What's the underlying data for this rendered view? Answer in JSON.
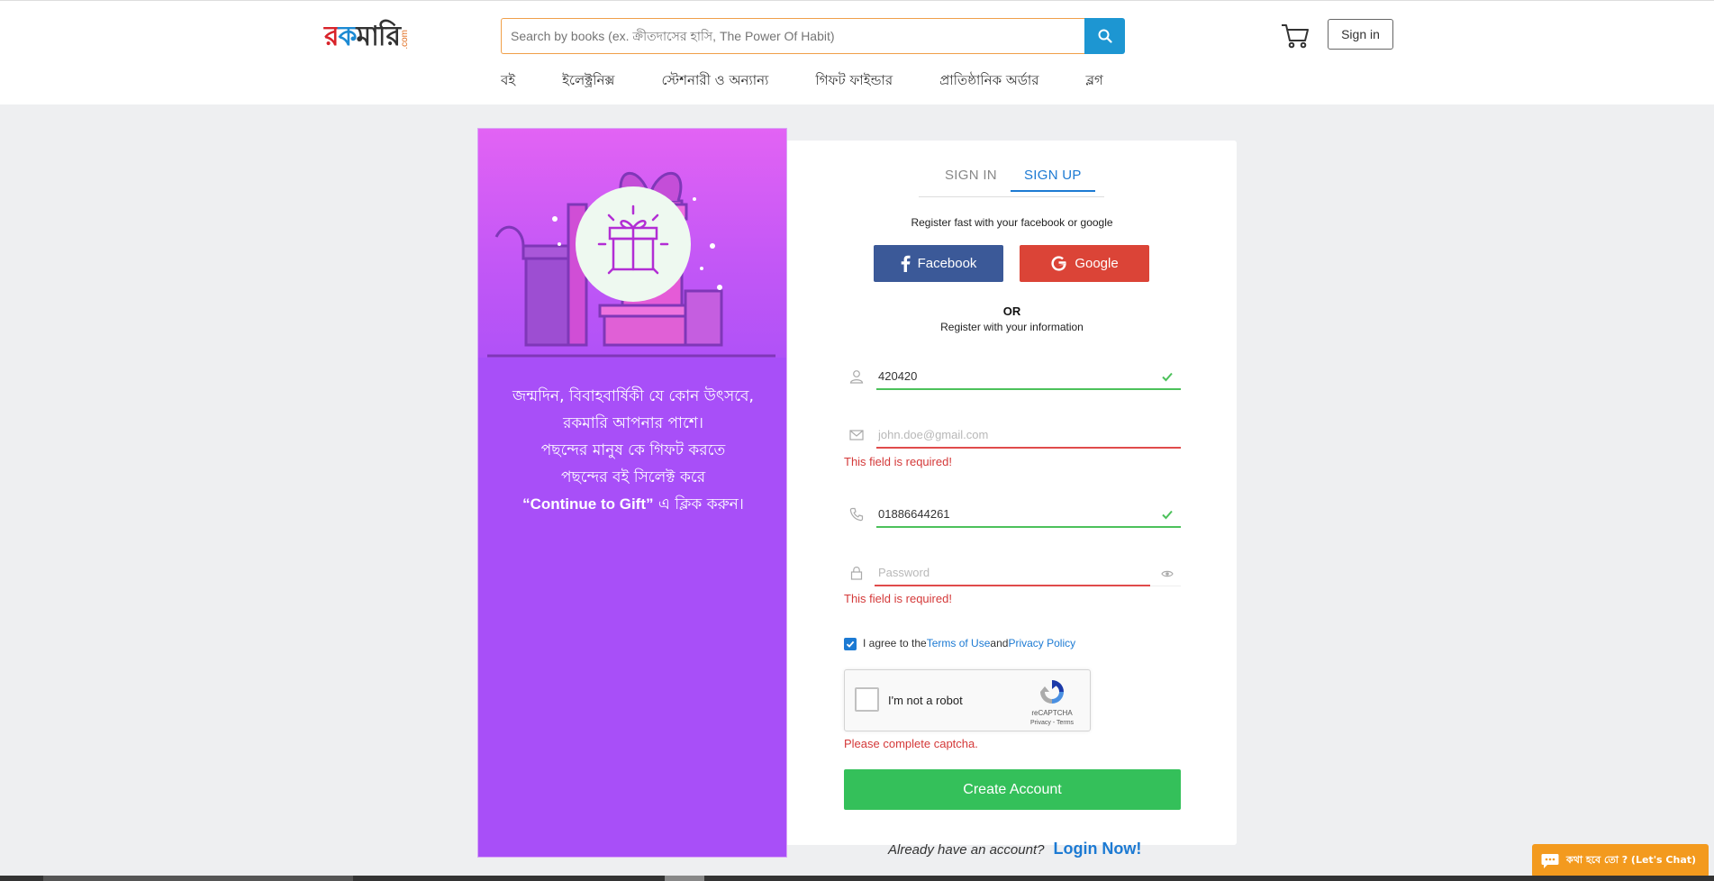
{
  "header": {
    "logo_text": [
      "র",
      "ক",
      "মারি"
    ],
    "logo_suffix": ".com",
    "search": {
      "placeholder": "Search by books (ex. ক্রীতদাসের হাসি, The Power Of Habit)",
      "button_color": "#1d96d2"
    },
    "cart_icon": "cart-icon",
    "signin_label": "Sign in",
    "nav": [
      "বই",
      "ইলেক্ট্রনিক্স",
      "স্টেশনারী ও অন্যান্য",
      "গিফট ফাইন্ডার",
      "প্রাতিষ্ঠানিক অর্ডার",
      "ব্লগ"
    ]
  },
  "promo": {
    "lines": [
      "জন্মদিন, বিবাহবার্ষিকী যে কোন উৎসবে,",
      "রকমারি আপনার পাশে।",
      "পছন্দের মানুষ কে গিফট করতে",
      "পছন্দের বই সিলেক্ট করে"
    ],
    "gift_quote": "“Continue to Gift”",
    "gift_suffix": " এ ক্লিক করুন।",
    "bg_color": "#a84ff8"
  },
  "form": {
    "tabs": [
      {
        "label": "SIGN IN",
        "active": false
      },
      {
        "label": "SIGN UP",
        "active": true
      }
    ],
    "social_title": "Register fast with your facebook or google",
    "facebook_label": "Facebook",
    "google_label": "Google",
    "or_label": "OR",
    "register_info": "Register with your information",
    "name": {
      "value": "420420",
      "valid": true
    },
    "email": {
      "value": "",
      "placeholder": "john.doe@gmail.com",
      "error": "This field is required!"
    },
    "phone": {
      "value": "01886644261",
      "valid": true
    },
    "password": {
      "value": "",
      "placeholder": "Password",
      "error": "This field is required!"
    },
    "agree": {
      "checked": true,
      "prefix": "I agree to the ",
      "terms": "Terms of Use",
      "and": " and ",
      "privacy": "Privacy Policy"
    },
    "recaptcha": {
      "label": "I'm not a robot",
      "brand": "reCAPTCHA",
      "links": "Privacy - Terms"
    },
    "captcha_error": "Please complete captcha.",
    "create_label": "Create Account"
  },
  "footer": {
    "already_text": "Already have an account?",
    "login_now": "Login Now!"
  },
  "chat": {
    "label": "কথা হবে তো ? (Let's Chat)",
    "color": "#f39a1e"
  },
  "colors": {
    "accent_blue": "#1c7ad3",
    "valid_green": "#4cc15b",
    "error_red": "#d43939",
    "facebook": "#3b5998",
    "google": "#db4437",
    "create_green": "#34c05a"
  }
}
